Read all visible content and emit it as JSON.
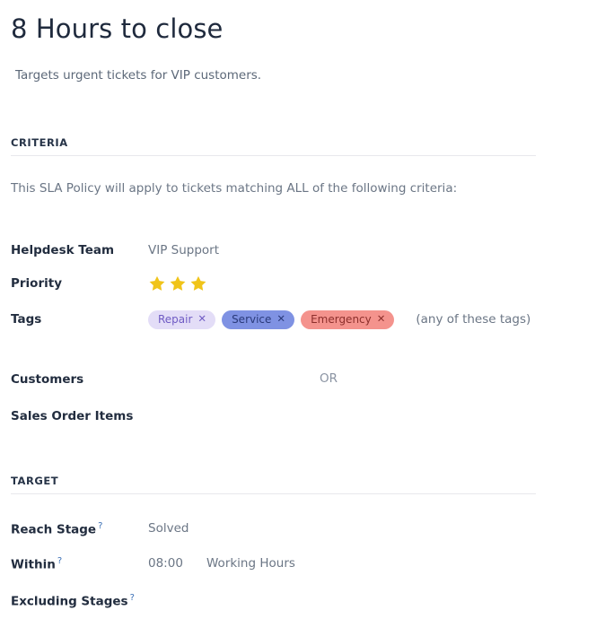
{
  "header": {
    "title": "8 Hours to close",
    "subtitle": "Targets urgent tickets for VIP customers."
  },
  "criteria": {
    "section_title": "CRITERIA",
    "intro": "This SLA Policy will apply to tickets matching ALL of the following criteria:",
    "rows": {
      "helpdesk_team": {
        "label": "Helpdesk Team",
        "value": "VIP Support"
      },
      "priority": {
        "label": "Priority",
        "stars_filled": 3
      },
      "tags": {
        "label": "Tags",
        "hint": "(any of these tags)",
        "items": [
          {
            "label": "Repair",
            "bg": "#e3ddf7",
            "fg": "#6f5bc4",
            "remove_icon": "✕"
          },
          {
            "label": "Service",
            "bg": "#7f92e3",
            "fg": "#2a3a7a",
            "remove_icon": "✕"
          },
          {
            "label": "Emergency",
            "bg": "#f4938d",
            "fg": "#8d2f2c",
            "remove_icon": "✕"
          }
        ]
      },
      "customers": {
        "label": "Customers",
        "value": ""
      },
      "or_separator": "OR",
      "sales_order_items": {
        "label": "Sales Order Items",
        "value": ""
      }
    }
  },
  "target": {
    "section_title": "TARGET",
    "rows": {
      "reach_stage": {
        "label": "Reach Stage",
        "help": "?",
        "value": "Solved"
      },
      "within": {
        "label": "Within",
        "help": "?",
        "time": "08:00",
        "unit": "Working Hours"
      },
      "excluding_stages": {
        "label": "Excluding Stages",
        "help": "?",
        "value": ""
      }
    }
  },
  "colors": {
    "star": "#f0c419",
    "heading": "#263347",
    "label": "#222d3f",
    "value": "#6b7685",
    "help": "#3a6fb5",
    "rule": "#e8e8ec"
  }
}
